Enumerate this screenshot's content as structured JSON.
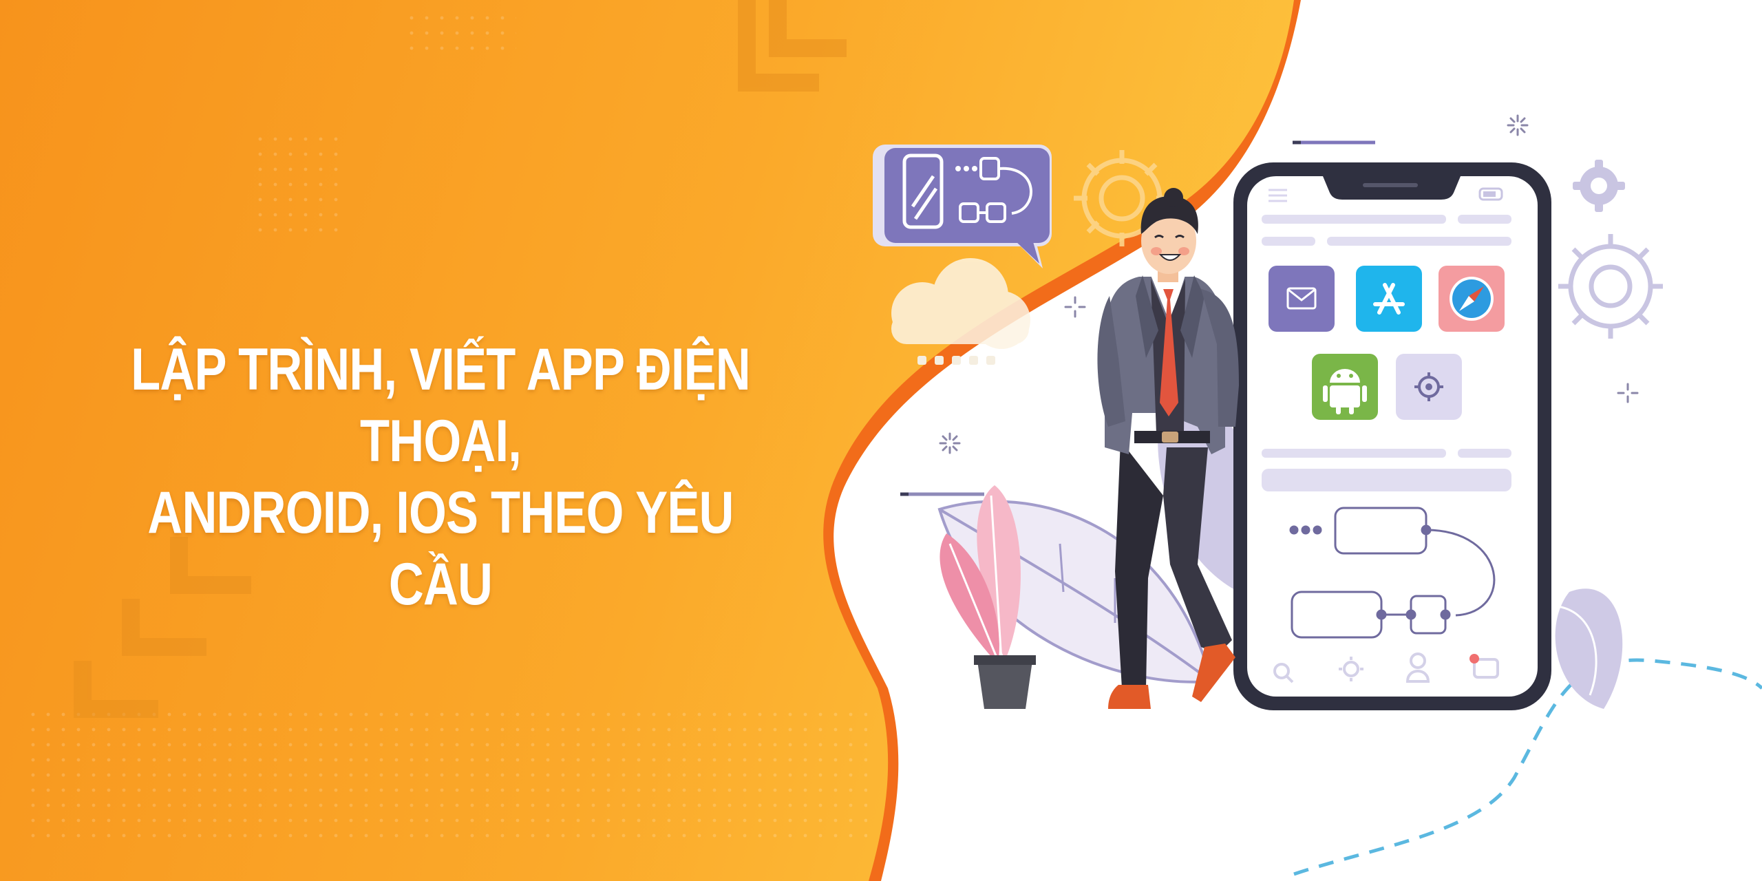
{
  "headline": {
    "line1": "LẬP TRÌNH, VIẾT APP ĐIỆN THOẠI,",
    "line2": "ANDROID, IOS THEO YÊU CẦU"
  },
  "colors": {
    "orange_dark": "#F7941D",
    "orange_light": "#FDBA38",
    "orange_edge": "#F26C1A",
    "purple": "#7E76BB",
    "lavender": "#D9D5EE",
    "phone_frame": "#2F3040",
    "app_store_blue": "#1FB5EC",
    "safari_red": "#F49CA0",
    "android_green": "#7AB648",
    "tie_red": "#E2553E",
    "plant_pink": "#F29AB0",
    "dash_blue": "#5BB8E0"
  },
  "icons": [
    "phone-flowchart-icon",
    "cloud-icon",
    "gear-icon",
    "mail-icon",
    "app-store-icon",
    "safari-compass-icon",
    "android-icon",
    "settings-icon",
    "search-icon",
    "user-icon",
    "chat-icon"
  ]
}
